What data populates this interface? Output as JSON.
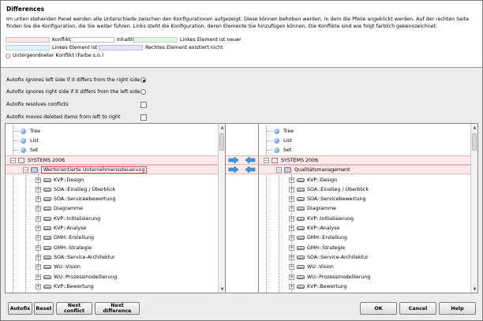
{
  "header": {
    "title": "Differences",
    "description": "Im unten stehenden Panel werden alle Unterschiede zwischen den Konfigurationen aufgezeigt. Diese können behoben werden, in dem die Pfeile angeklickt werden. Auf der rechten Seite finden Sie die Konfiguration, die Sie weiter führen. Links steht die Konfiguration, deren Elemente Sie hinzufügen können. Die Konflikte sind wie folgt farblich gekennzeichnet:"
  },
  "legend": {
    "conflict": {
      "label": "Konflikt",
      "color": "#fde9e9"
    },
    "equality": {
      "label": "Inhaltliche Gleichheit",
      "color": "#ffffff"
    },
    "left_newer": {
      "label": "Linkes Element ist neuer",
      "color": "#e6f4e6"
    },
    "left_older": {
      "label": "Linkes Element ist älter",
      "color": "#e6f2fb"
    },
    "right_missing": {
      "label": "Rechtes Element existiert nicht",
      "color": "#e5e5f7"
    },
    "sub_conflict": {
      "label": "Untergeordneter Konflikt (Farbe s.o.)"
    }
  },
  "options": [
    {
      "label": "Autofix ignores left side if it differs from the right side",
      "type": "radio",
      "checked": true
    },
    {
      "label": "Autofix ignores right side if it differs from the left side",
      "type": "radio",
      "checked": false
    },
    {
      "label": "Autofix resolves conflicts",
      "type": "checkbox",
      "checked": false
    },
    {
      "label": "Autofix moves deleted items from left to right",
      "type": "checkbox",
      "checked": false
    }
  ],
  "left_tree": {
    "top": [
      "Tree",
      "List",
      "Set"
    ],
    "root": "SYSTEMS 2006",
    "folder": "Wertorientierte Unternehmenssteuerung",
    "items": [
      "KVP::Design",
      "SOA::Einstieg / Überblick",
      "SOA::Serviceebewertung",
      "Diagramme",
      "KVP::Initialisierung",
      "KVP::Analyse",
      "GMH::Erstellung",
      "GMH::Strategie",
      "SOA::Service-Architektur",
      "WU::Vision",
      "WU::Prozessmodellierung",
      "KVP::Bewertung"
    ]
  },
  "right_tree": {
    "top": [
      "Tree",
      "List",
      "Set"
    ],
    "root": "SYSTEMS 2006",
    "folder": "Qualitätsmanagement",
    "items": [
      "KVP::Design",
      "SOA::Einstieg / Überblick",
      "SOA::Servicebewertung",
      "Diagramme",
      "KVP::Initialisierung",
      "KVP::Analyse",
      "GMH::Erstellung",
      "GMH::Strategie",
      "SOA::Service-Architektur",
      "WU::Vision",
      "WU::Prozessmodellierung",
      "KVP::Bewertung"
    ]
  },
  "buttons": {
    "autofix": "Autofix",
    "reset": "Reset",
    "next_conflict": "Next conflict",
    "next_difference": "Next difference",
    "ok": "OK",
    "cancel": "Cancel",
    "help": "Help"
  }
}
